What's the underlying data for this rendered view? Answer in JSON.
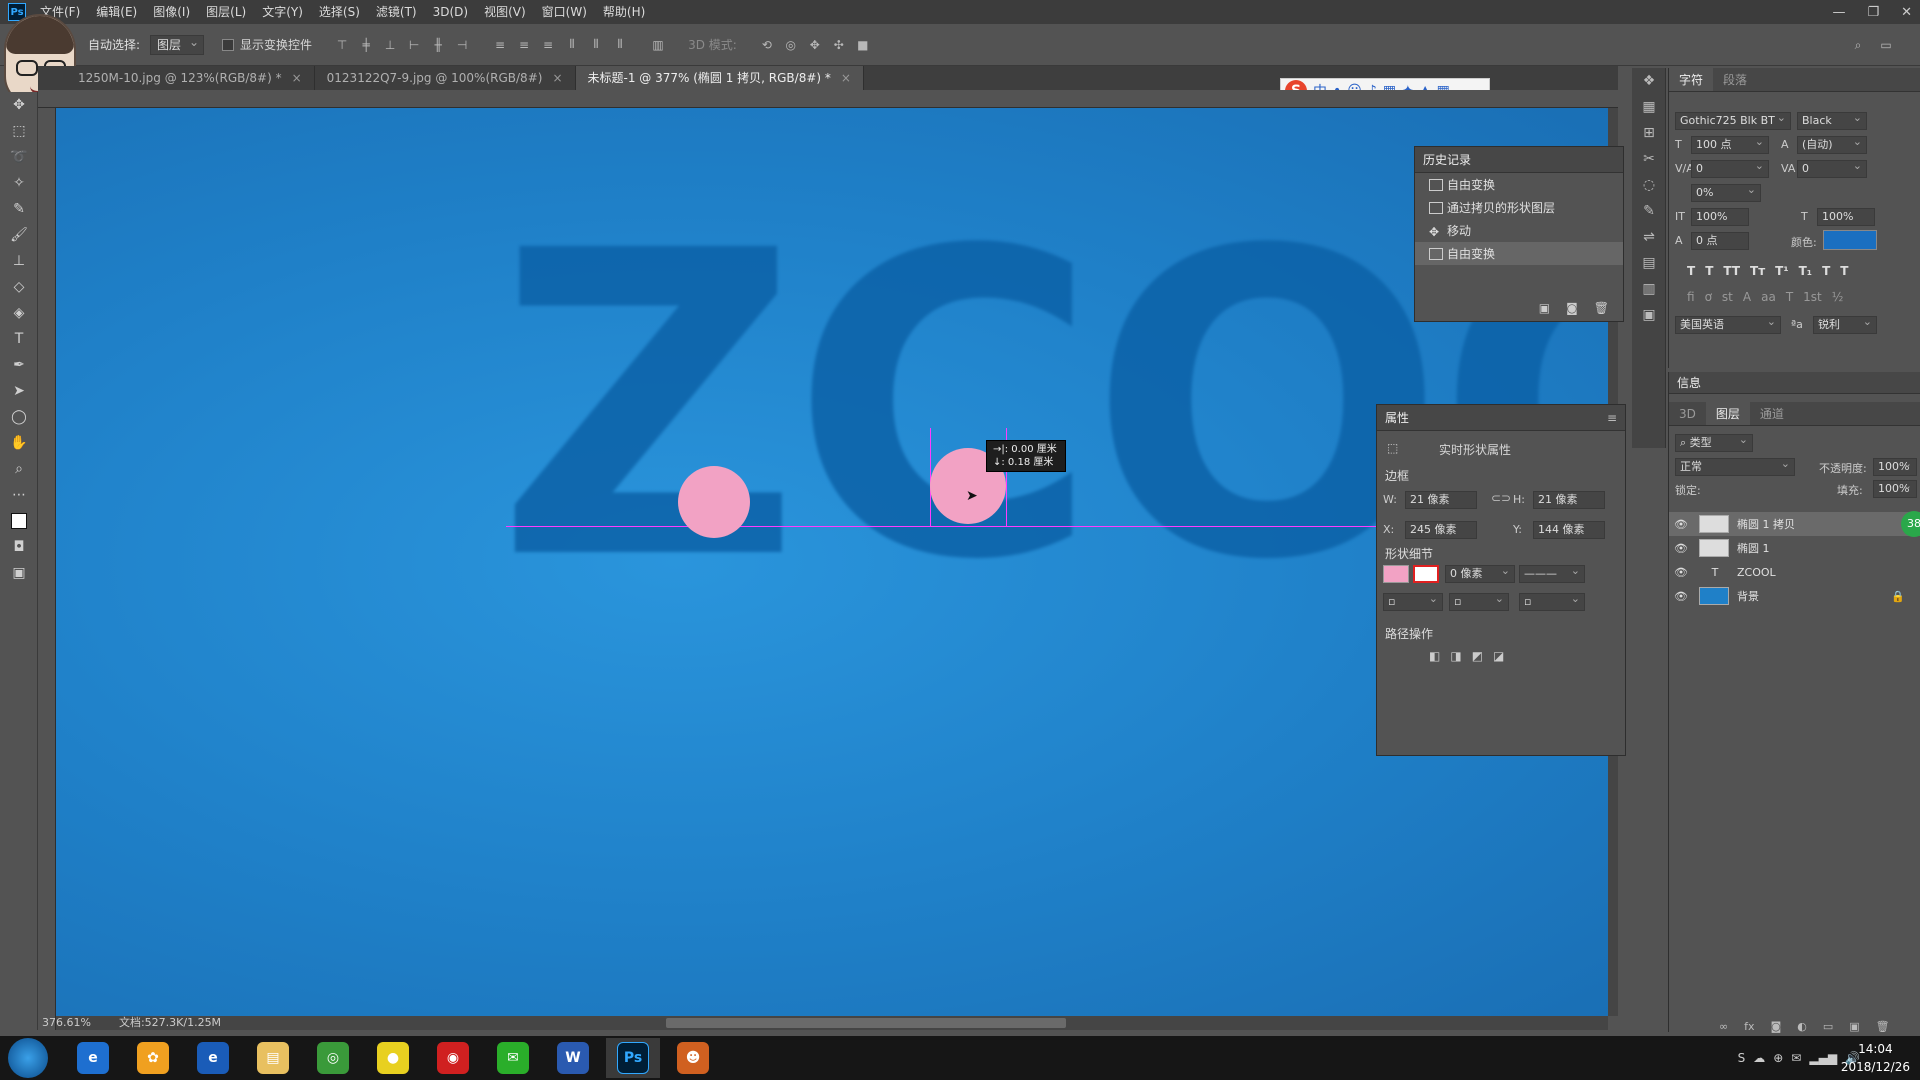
{
  "app": {
    "logo": "Ps"
  },
  "menu": [
    "文件(F)",
    "编辑(E)",
    "图像(I)",
    "图层(L)",
    "文字(Y)",
    "选择(S)",
    "滤镜(T)",
    "3D(D)",
    "视图(V)",
    "窗口(W)",
    "帮助(H)"
  ],
  "options": {
    "auto_select_label": "自动选择:",
    "auto_select_value": "图层",
    "show_transform_label": "显示变换控件",
    "mode3d_label": "3D 模式:"
  },
  "tabs": [
    {
      "label": "1250M-10.jpg @ 123%(RGB/8#) *"
    },
    {
      "label": "0123122Q7-9.jpg @ 100%(RGB/8#)"
    },
    {
      "label": "未标题-1 @ 377% (椭圆 1 拷贝, RGB/8#) *"
    }
  ],
  "canvas": {
    "text": "ZCOOL",
    "background": "#1f80c8",
    "circle_color": "#f2a2c4"
  },
  "tooltip": {
    "line1": "→|: 0.00 厘米",
    "line2": "↓: 0.18 厘米"
  },
  "status": {
    "zoom": "376.61%",
    "doc": "文档:527.3K/1.25M"
  },
  "ime": {
    "mode": "中"
  },
  "character": {
    "tabs": [
      "字符",
      "段落"
    ],
    "font": "Gothic725 Blk BT",
    "style": "Black",
    "size": "100 点",
    "leading": "(自动)",
    "kerning": "0",
    "tracking": "0",
    "scale_pct": "0%",
    "vscale": "100%",
    "hscale": "100%",
    "baseline": "0 点",
    "color_label": "颜色:",
    "color": "#1a6fc0",
    "language": "美国英语",
    "aa": "锐利"
  },
  "info_tab": "信息",
  "history": {
    "title": "历史记录",
    "items": [
      "自由变换",
      "通过拷贝的形状图层",
      "移动",
      "自由变换"
    ]
  },
  "properties": {
    "title": "属性",
    "subtitle": "实时形状属性",
    "sec_frame": "边框",
    "w_label": "W:",
    "w": "21 像素",
    "h_label": "H:",
    "h": "21 像素",
    "x_label": "X:",
    "x": "245 像素",
    "y_label": "Y:",
    "y": "144 像素",
    "sec_shape": "形状细节",
    "stroke": "0 像素",
    "sec_path": "路径操作"
  },
  "layers": {
    "tabs": [
      "3D",
      "图层",
      "通道"
    ],
    "filter": "类型",
    "blend": "正常",
    "opacity_label": "不透明度:",
    "opacity": "100%",
    "lock_label": "锁定:",
    "fill_label": "填充:",
    "fill": "100%",
    "items": [
      {
        "name": "椭圆 1 拷贝",
        "selected": true
      },
      {
        "name": "椭圆 1"
      },
      {
        "name": "ZCOOL"
      },
      {
        "name": "背景"
      }
    ],
    "badge": "38"
  },
  "clock": {
    "time": "14:04",
    "date": "2018/12/26"
  }
}
